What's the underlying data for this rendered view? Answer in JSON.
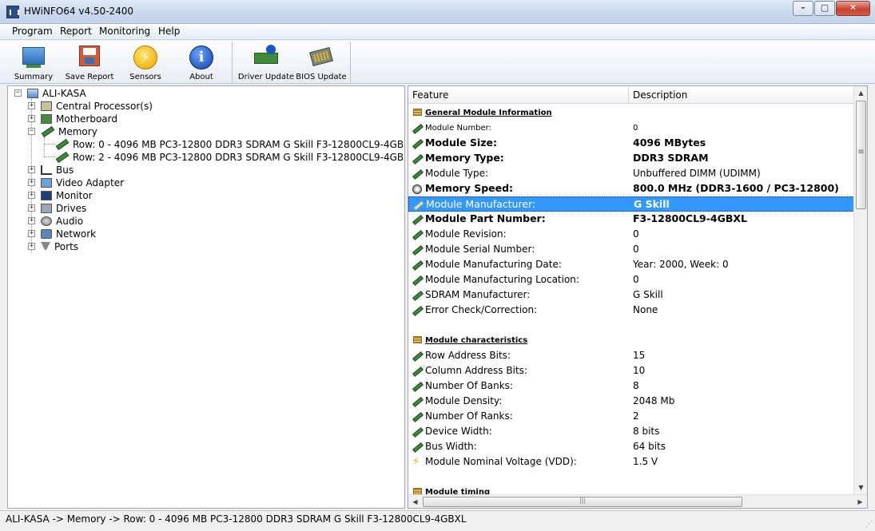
{
  "window": {
    "title": "HWiNFO64 v4.50-2400"
  },
  "menu": [
    "Program",
    "Report",
    "Monitoring",
    "Help"
  ],
  "toolbar": {
    "summary": "Summary",
    "save_report": "Save Report",
    "sensors": "Sensors",
    "about": "About",
    "driver_update": "Driver Update",
    "bios_update": "BIOS Update"
  },
  "tree": {
    "root": "ALI-KASA",
    "cpu": "Central Processor(s)",
    "motherboard": "Motherboard",
    "memory": "Memory",
    "row0": "Row: 0 - 4096 MB PC3-12800 DDR3 SDRAM G Skill F3-12800CL9-4GBXL",
    "row2": "Row: 2 - 4096 MB PC3-12800 DDR3 SDRAM G Skill F3-12800CL9-4GBXL",
    "bus": "Bus",
    "video": "Video Adapter",
    "monitor": "Monitor",
    "drives": "Drives",
    "audio": "Audio",
    "network": "Network",
    "ports": "Ports"
  },
  "details": {
    "header_feature": "Feature",
    "header_description": "Description",
    "rows": [
      {
        "feature": "General Module Information",
        "description": ""
      },
      {
        "feature": "Module Number:",
        "description": "0"
      },
      {
        "feature": "Module Size:",
        "description": "4096 MBytes"
      },
      {
        "feature": "Memory Type:",
        "description": "DDR3 SDRAM"
      },
      {
        "feature": "Module Type:",
        "description": "Unbuffered DIMM (UDIMM)"
      },
      {
        "feature": "Memory Speed:",
        "description": "800.0 MHz (DDR3-1600 / PC3-12800)"
      },
      {
        "feature": "Module Manufacturer:",
        "description": "G Skill"
      },
      {
        "feature": "Module Part Number:",
        "description": "F3-12800CL9-4GBXL"
      },
      {
        "feature": "Module Revision:",
        "description": "0"
      },
      {
        "feature": "Module Serial Number:",
        "description": "0"
      },
      {
        "feature": "Module Manufacturing Date:",
        "description": "Year: 2000, Week: 0"
      },
      {
        "feature": "Module Manufacturing Location:",
        "description": "0"
      },
      {
        "feature": "SDRAM Manufacturer:",
        "description": "G Skill"
      },
      {
        "feature": "Error Check/Correction:",
        "description": "None"
      },
      {
        "feature": "Module characteristics",
        "description": ""
      },
      {
        "feature": "Row Address Bits:",
        "description": "15"
      },
      {
        "feature": "Column Address Bits:",
        "description": "10"
      },
      {
        "feature": "Number Of Banks:",
        "description": "8"
      },
      {
        "feature": "Module Density:",
        "description": "2048 Mb"
      },
      {
        "feature": "Number Of Ranks:",
        "description": "2"
      },
      {
        "feature": "Device Width:",
        "description": "8 bits"
      },
      {
        "feature": "Bus Width:",
        "description": "64 bits"
      },
      {
        "feature": "Module Nominal Voltage (VDD):",
        "description": "1.5 V"
      },
      {
        "feature": "Module timing",
        "description": ""
      }
    ]
  },
  "status": {
    "path": "ALI-KASA -> Memory -> Row: 0 - 4096 MB PC3-12800 DDR3 SDRAM G Skill F3-12800CL9-4GBXL"
  }
}
